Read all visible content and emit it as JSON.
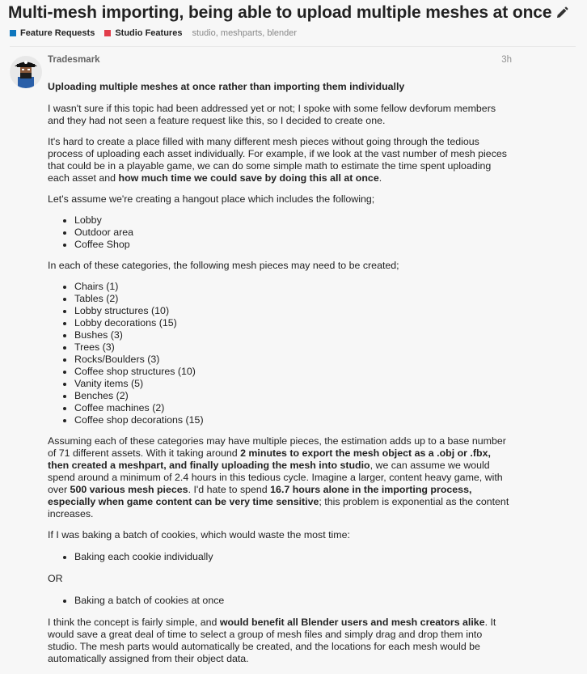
{
  "topic": {
    "title": "Multi-mesh importing, being able to upload multiple meshes at once"
  },
  "categories": [
    {
      "label": "Feature Requests",
      "color": "#0e76bd"
    },
    {
      "label": "Studio Features",
      "color": "#e23d4b"
    }
  ],
  "tags": "studio, meshparts, blender",
  "post": {
    "username": "Tradesmark",
    "time": "3h",
    "heading": "Uploading multiple meshes at once rather than importing them individually",
    "p1": "I wasn't sure if this topic had been addressed yet or not; I spoke with some fellow devforum members and they had not seen a feature request like this, so I decided to create one.",
    "p2a": "It's hard to create a place filled with many different mesh pieces without going through the tedious process of uploading each asset individually. For example, if we look at the vast number of mesh pieces that could be in a playable game, we can do some simple math to estimate the time spent uploading each asset and ",
    "p2b": "how much time we could save by doing this all at once",
    "p2c": ".",
    "p3": "Let's assume we're creating a hangout place which includes the following;",
    "list1": [
      "Lobby",
      "Outdoor area",
      "Coffee Shop"
    ],
    "p4": "In each of these categories, the following mesh pieces may need to be created;",
    "list2": [
      "Chairs (1)",
      "Tables (2)",
      "Lobby structures (10)",
      "Lobby decorations (15)",
      "Bushes (3)",
      "Trees (3)",
      "Rocks/Boulders (3)",
      "Coffee shop structures (10)",
      "Vanity items (5)",
      "Benches (2)",
      "Coffee machines (2)",
      "Coffee shop decorations (15)"
    ],
    "p5a": "Assuming each of these categories may have multiple pieces, the estimation adds up to a base number of 71 different assets. With it taking around ",
    "p5b": "2 minutes to export the mesh object as a .obj or .fbx, then created a meshpart, and finally uploading the mesh into studio",
    "p5c": ", we can assume we would spend around a minimum of 2.4 hours in this tedious cycle. Imagine a larger, content heavy game, with over ",
    "p5d": "500 various mesh pieces",
    "p5e": ". I'd hate to spend ",
    "p5f": "16.7 hours alone in the importing process, especially when game content can be very time sensitive",
    "p5g": "; this problem is exponential as the content increases.",
    "p6": "If I was baking a batch of cookies, which would waste the most time:",
    "list3": [
      "Baking each cookie individually"
    ],
    "p7": "OR",
    "list4": [
      "Baking a batch of cookies at once"
    ],
    "p8a": "I think the concept is fairly simple, and ",
    "p8b": "would benefit all Blender users and mesh creators alike",
    "p8c": ". It would save a great deal of time to select a group of mesh files and simply drag and drop them into studio. The mesh parts would automatically be created, and the locations for each mesh would be automatically assigned from their object data."
  }
}
